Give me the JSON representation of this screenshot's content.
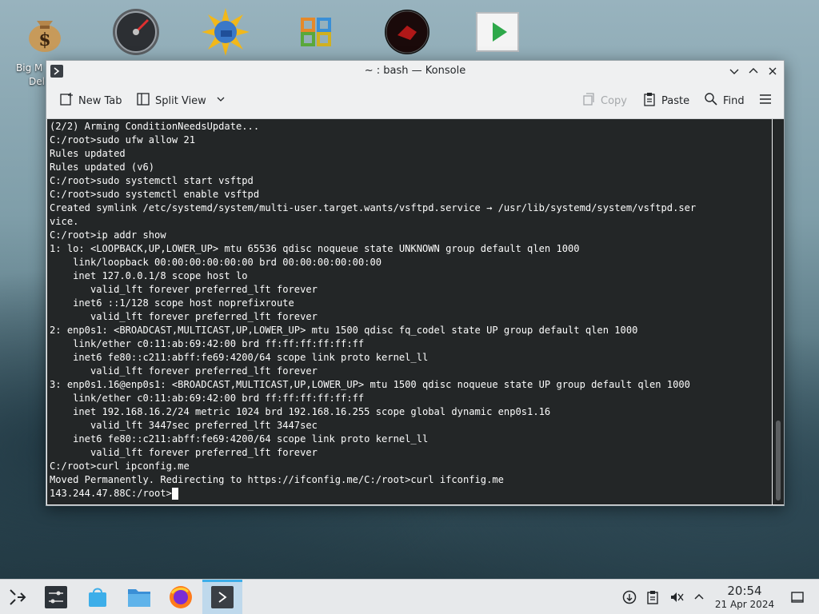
{
  "desktop": {
    "icons": [
      {
        "name": "money-bag-icon"
      },
      {
        "name": "speedometer-icon"
      },
      {
        "name": "sun-disk-icon"
      },
      {
        "name": "network-app-icon"
      },
      {
        "name": "red-app-icon"
      },
      {
        "name": "media-player-icon"
      }
    ],
    "label_line1": "Big M",
    "label_line2": "Del"
  },
  "window": {
    "title": "~ : bash — Konsole",
    "toolbar": {
      "new_tab": "New Tab",
      "split_view": "Split View",
      "copy": "Copy",
      "paste": "Paste",
      "find": "Find"
    }
  },
  "terminal": {
    "lines": [
      "(2/2) Arming ConditionNeedsUpdate...",
      "C:/root>sudo ufw allow 21",
      "Rules updated",
      "Rules updated (v6)",
      "C:/root>sudo systemctl start vsftpd",
      "C:/root>sudo systemctl enable vsftpd",
      "Created symlink /etc/systemd/system/multi-user.target.wants/vsftpd.service → /usr/lib/systemd/system/vsftpd.ser",
      "vice.",
      "C:/root>ip addr show",
      "1: lo: <LOOPBACK,UP,LOWER_UP> mtu 65536 qdisc noqueue state UNKNOWN group default qlen 1000",
      "    link/loopback 00:00:00:00:00:00 brd 00:00:00:00:00:00",
      "    inet 127.0.0.1/8 scope host lo",
      "       valid_lft forever preferred_lft forever",
      "    inet6 ::1/128 scope host noprefixroute",
      "       valid_lft forever preferred_lft forever",
      "2: enp0s1: <BROADCAST,MULTICAST,UP,LOWER_UP> mtu 1500 qdisc fq_codel state UP group default qlen 1000",
      "    link/ether c0:11:ab:69:42:00 brd ff:ff:ff:ff:ff:ff",
      "    inet6 fe80::c211:abff:fe69:4200/64 scope link proto kernel_ll",
      "       valid_lft forever preferred_lft forever",
      "3: enp0s1.16@enp0s1: <BROADCAST,MULTICAST,UP,LOWER_UP> mtu 1500 qdisc noqueue state UP group default qlen 1000",
      "    link/ether c0:11:ab:69:42:00 brd ff:ff:ff:ff:ff:ff",
      "    inet 192.168.16.2/24 metric 1024 brd 192.168.16.255 scope global dynamic enp0s1.16",
      "       valid_lft 3447sec preferred_lft 3447sec",
      "    inet6 fe80::c211:abff:fe69:4200/64 scope link proto kernel_ll",
      "       valid_lft forever preferred_lft forever",
      "C:/root>curl ipconfig.me",
      "Moved Permanently. Redirecting to https://ifconfig.me/C:/root>curl ifconfig.me"
    ],
    "prompt_line": "143.244.47.88C:/root>"
  },
  "taskbar": {
    "time": "20:54",
    "date": "21 Apr 2024"
  }
}
